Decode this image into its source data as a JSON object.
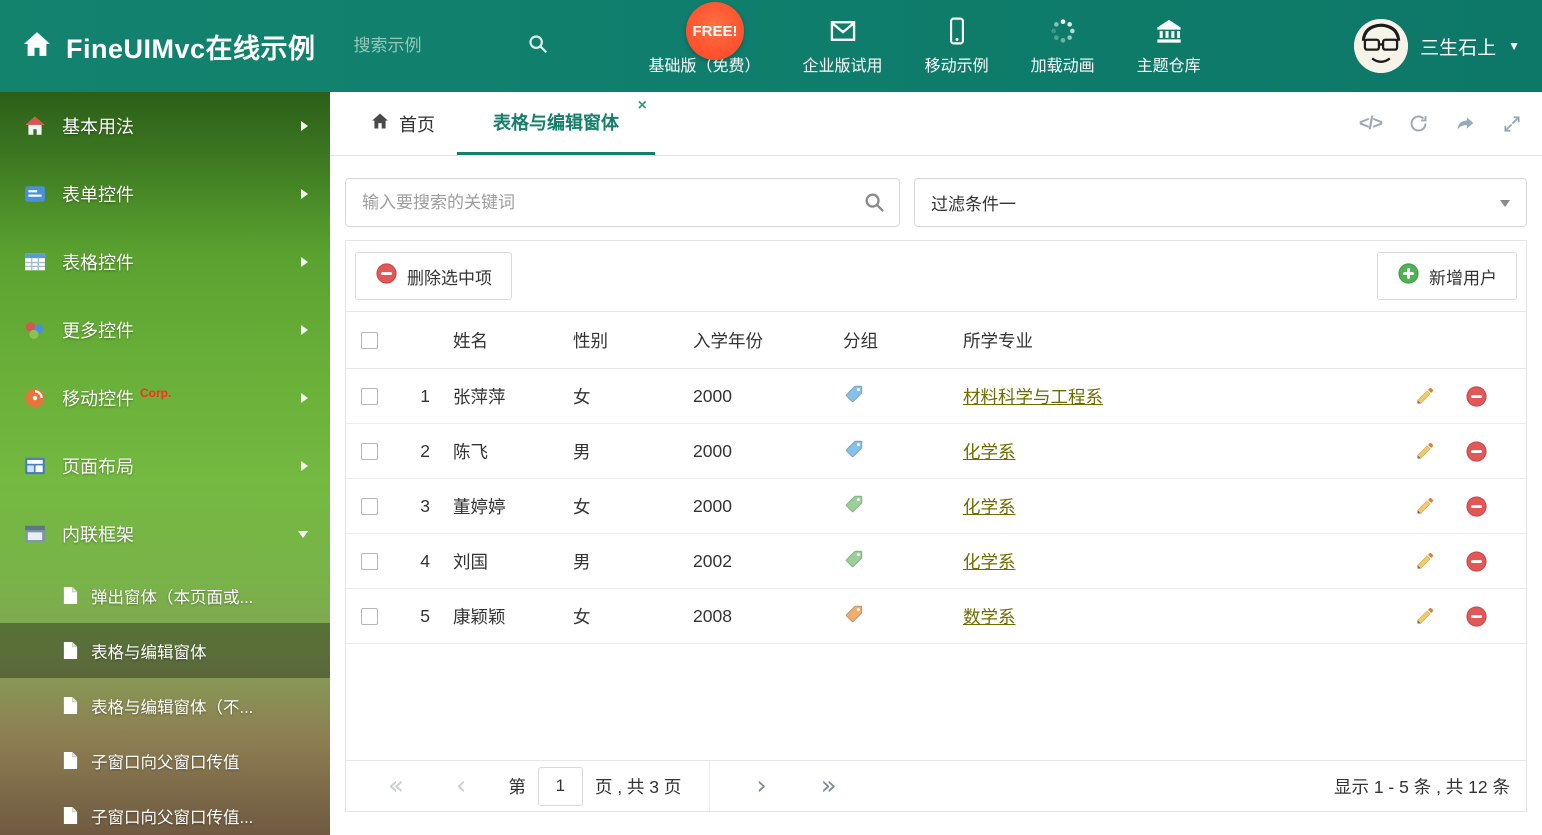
{
  "header": {
    "title": "FineUIMvc在线示例",
    "search_placeholder": "搜索示例",
    "free_badge": "FREE!",
    "nav": [
      {
        "label": "基础版（免费）"
      },
      {
        "label": "企业版试用"
      },
      {
        "label": "移动示例"
      },
      {
        "label": "加载动画"
      },
      {
        "label": "主题仓库"
      }
    ],
    "user": {
      "name": "三生石上"
    }
  },
  "sidebar": {
    "items": [
      {
        "label": "基本用法"
      },
      {
        "label": "表单控件"
      },
      {
        "label": "表格控件"
      },
      {
        "label": "更多控件"
      },
      {
        "label": "移动控件",
        "badge": "Corp."
      },
      {
        "label": "页面布局"
      },
      {
        "label": "内联框架"
      }
    ],
    "subitems": [
      {
        "label": "弹出窗体（本页面或..."
      },
      {
        "label": "表格与编辑窗体"
      },
      {
        "label": "表格与编辑窗体（不..."
      },
      {
        "label": "子窗口向父窗口传值"
      },
      {
        "label": "子窗口向父窗口传值..."
      }
    ]
  },
  "tabs": {
    "home_label": "首页",
    "active_label": "表格与编辑窗体"
  },
  "icons": {
    "close": "×",
    "code": "</>",
    "first": "«",
    "prev": "‹",
    "next": "›",
    "last": "»",
    "caret_down": "▼"
  },
  "content": {
    "search_placeholder": "输入要搜索的关键词",
    "filter_selected": "过滤条件一",
    "delete_button": "删除选中项",
    "add_button": "新增用户",
    "table": {
      "columns": [
        "姓名",
        "性别",
        "入学年份",
        "分组",
        "所学专业"
      ],
      "rows": [
        {
          "index": "1",
          "name": "张萍萍",
          "gender": "女",
          "year": "2000",
          "tag_color": "#85c1ea",
          "major": "材料科学与工程系"
        },
        {
          "index": "2",
          "name": "陈飞",
          "gender": "男",
          "year": "2000",
          "tag_color": "#85c1ea",
          "major": "化学系"
        },
        {
          "index": "3",
          "name": "董婷婷",
          "gender": "女",
          "year": "2000",
          "tag_color": "#98d098",
          "major": "化学系"
        },
        {
          "index": "4",
          "name": "刘国",
          "gender": "男",
          "year": "2002",
          "tag_color": "#98d098",
          "major": "化学系"
        },
        {
          "index": "5",
          "name": "康颖颖",
          "gender": "女",
          "year": "2008",
          "tag_color": "#f3ab6d",
          "major": "数学系"
        }
      ]
    },
    "pagination": {
      "prefix": "第",
      "page": "1",
      "suffix": "页 , 共 3 页",
      "summary": "显示 1 - 5 条 , 共 12 条"
    }
  },
  "colors": {
    "accent": "#157f6b",
    "link": "#6e6e00",
    "badge": "#ff5430"
  }
}
